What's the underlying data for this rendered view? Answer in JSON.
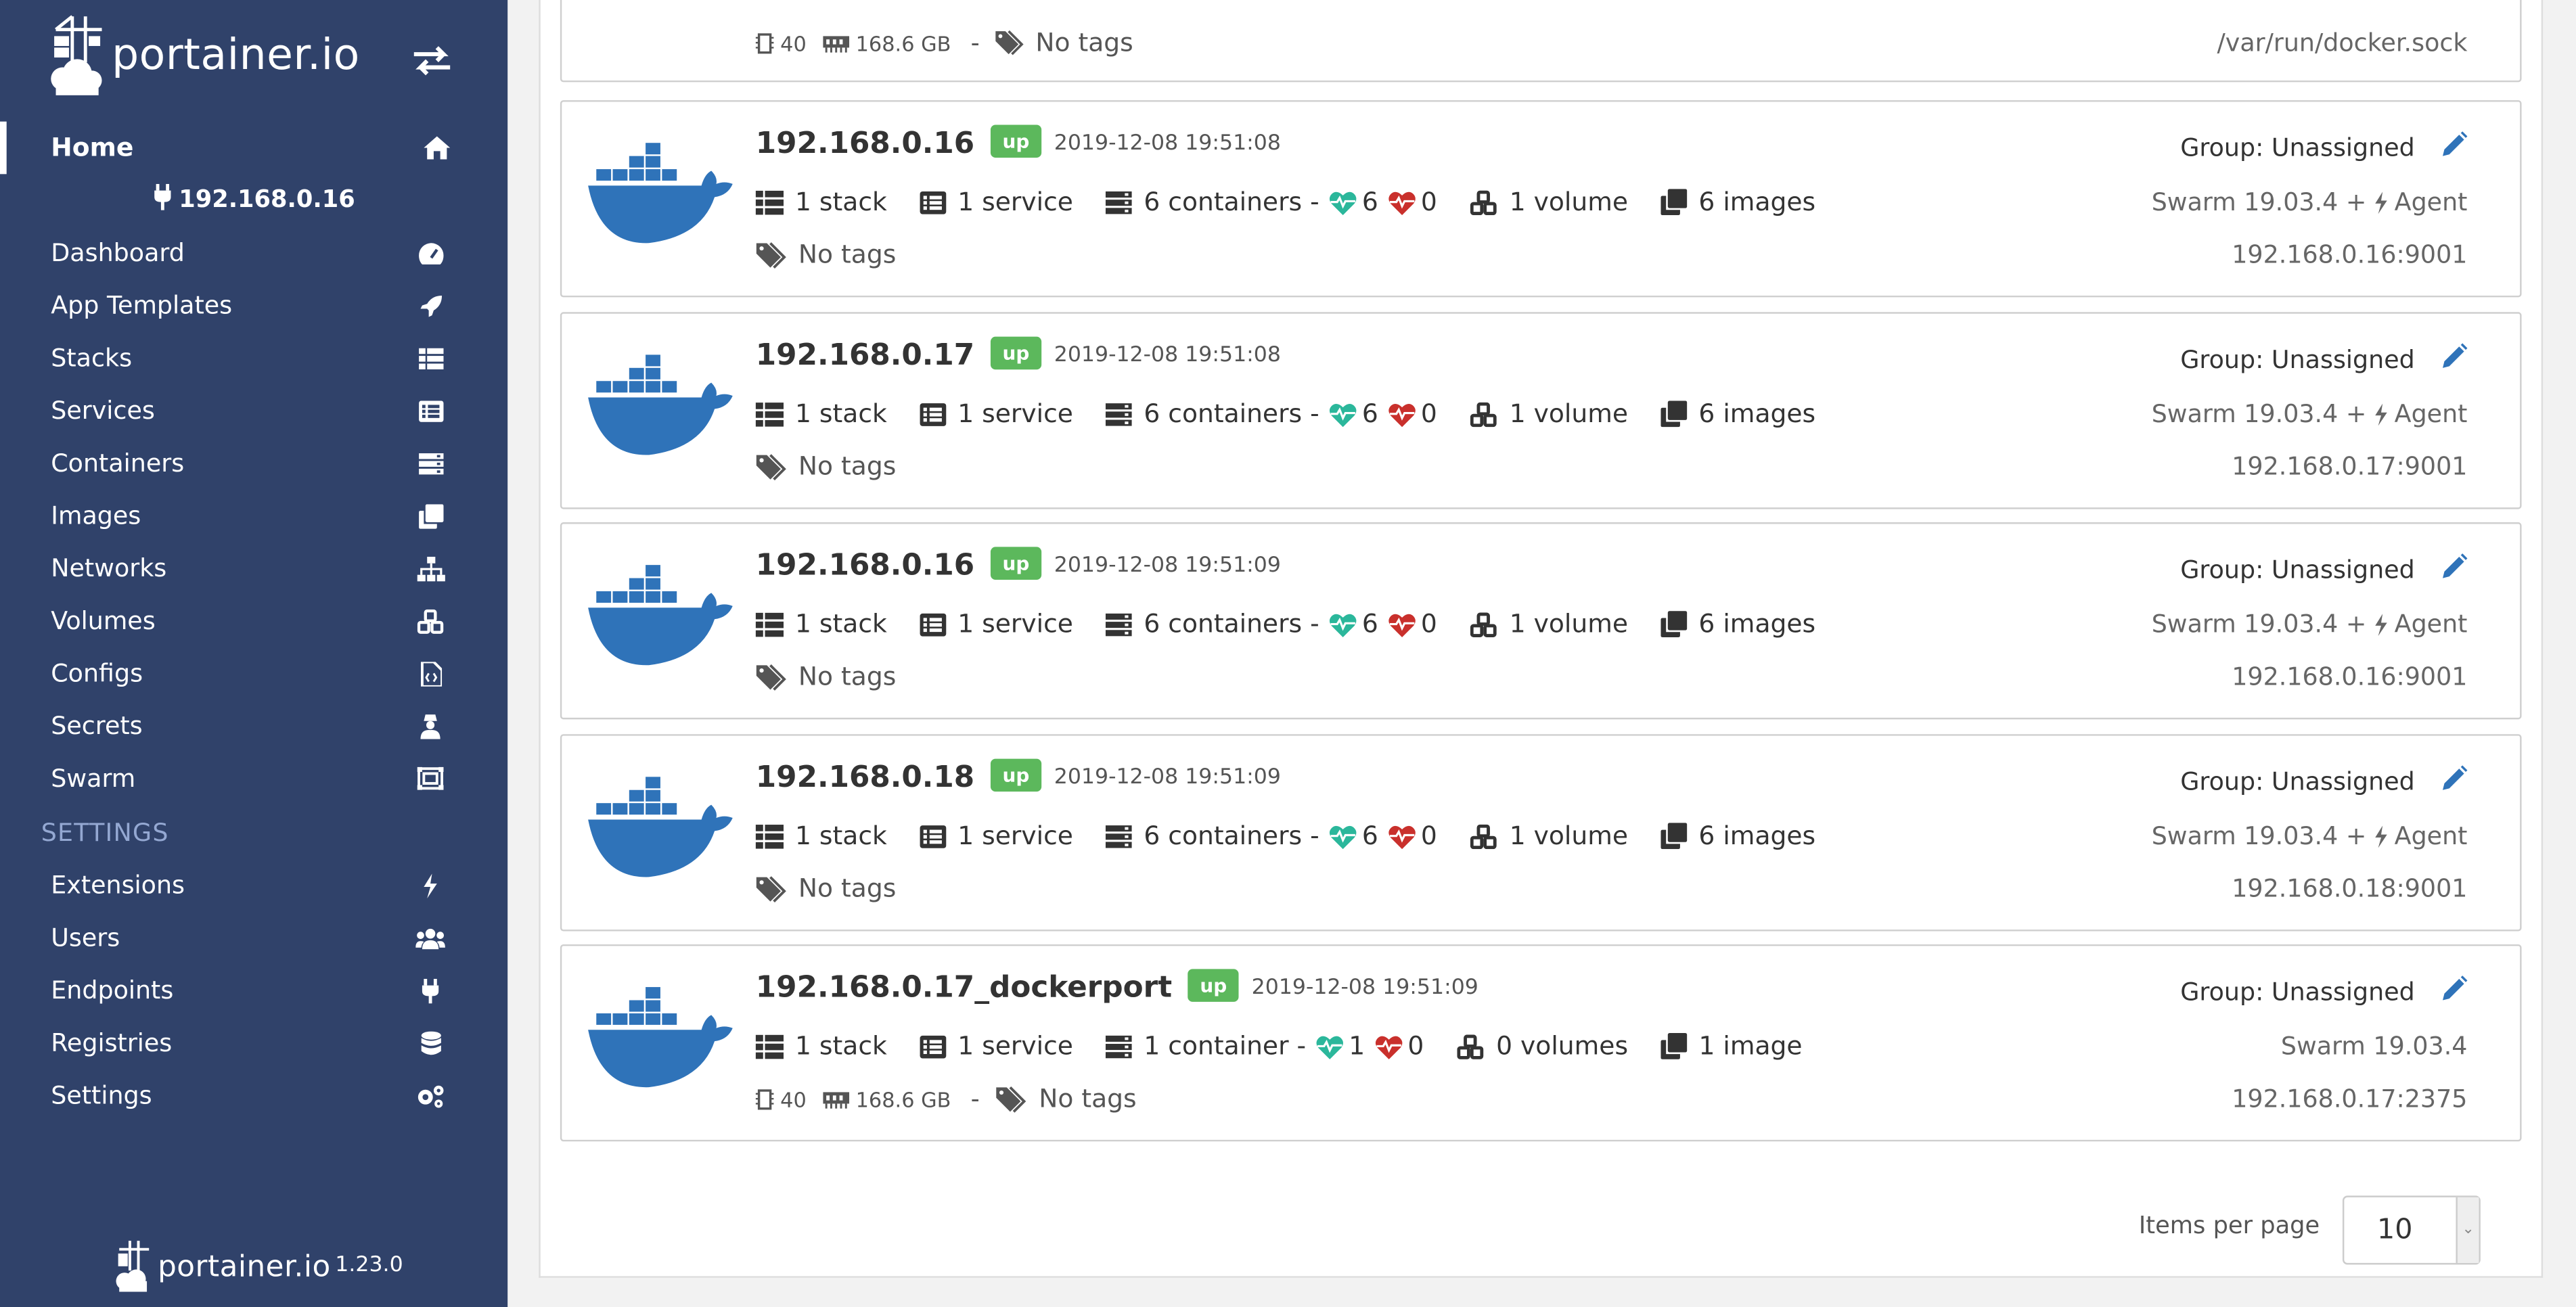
{
  "sidebar": {
    "brand": "portainer.io",
    "home": "Home",
    "endpoint": "192.168.0.16",
    "items": [
      {
        "label": "Dashboard",
        "icon": "tachometer-icon"
      },
      {
        "label": "App Templates",
        "icon": "rocket-icon"
      },
      {
        "label": "Stacks",
        "icon": "th-list-icon"
      },
      {
        "label": "Services",
        "icon": "list-alt-icon"
      },
      {
        "label": "Containers",
        "icon": "server-icon"
      },
      {
        "label": "Images",
        "icon": "clone-icon"
      },
      {
        "label": "Networks",
        "icon": "sitemap-icon"
      },
      {
        "label": "Volumes",
        "icon": "cubes-icon"
      },
      {
        "label": "Configs",
        "icon": "file-code-icon"
      },
      {
        "label": "Secrets",
        "icon": "user-secret-icon"
      },
      {
        "label": "Swarm",
        "icon": "object-group-icon"
      }
    ],
    "settings_header": "SETTINGS",
    "settings_items": [
      {
        "label": "Extensions",
        "icon": "bolt-icon"
      },
      {
        "label": "Users",
        "icon": "users-icon"
      },
      {
        "label": "Endpoints",
        "icon": "plug-icon"
      },
      {
        "label": "Registries",
        "icon": "database-icon"
      },
      {
        "label": "Settings",
        "icon": "cogs-icon"
      }
    ],
    "footer_brand": "portainer.io",
    "version": "1.23.0"
  },
  "top_partial": {
    "cpu": "40",
    "memory": "168.6 GB",
    "dash": "-",
    "tags": "No tags",
    "url": "/var/run/docker.sock"
  },
  "endpoints": [
    {
      "name": "192.168.0.16",
      "status": "up",
      "date": "2019-12-08 19:51:08",
      "stacks": "1 stack",
      "services": "1 service",
      "containers": "6 containers -",
      "healthy": "6",
      "unhealthy": "0",
      "volumes": "1 volume",
      "images": "6 images",
      "tags": "No tags",
      "group": "Group: Unassigned",
      "swarm": "Swarm 19.03.4 +",
      "agent": "Agent",
      "url": "192.168.0.16:9001"
    },
    {
      "name": "192.168.0.17",
      "status": "up",
      "date": "2019-12-08 19:51:08",
      "stacks": "1 stack",
      "services": "1 service",
      "containers": "6 containers -",
      "healthy": "6",
      "unhealthy": "0",
      "volumes": "1 volume",
      "images": "6 images",
      "tags": "No tags",
      "group": "Group: Unassigned",
      "swarm": "Swarm 19.03.4 +",
      "agent": "Agent",
      "url": "192.168.0.17:9001"
    },
    {
      "name": "192.168.0.16",
      "status": "up",
      "date": "2019-12-08 19:51:09",
      "stacks": "1 stack",
      "services": "1 service",
      "containers": "6 containers -",
      "healthy": "6",
      "unhealthy": "0",
      "volumes": "1 volume",
      "images": "6 images",
      "tags": "No tags",
      "group": "Group: Unassigned",
      "swarm": "Swarm 19.03.4 +",
      "agent": "Agent",
      "url": "192.168.0.16:9001"
    },
    {
      "name": "192.168.0.18",
      "status": "up",
      "date": "2019-12-08 19:51:09",
      "stacks": "1 stack",
      "services": "1 service",
      "containers": "6 containers -",
      "healthy": "6",
      "unhealthy": "0",
      "volumes": "1 volume",
      "images": "6 images",
      "tags": "No tags",
      "group": "Group: Unassigned",
      "swarm": "Swarm 19.03.4 +",
      "agent": "Agent",
      "url": "192.168.0.18:9001"
    },
    {
      "name": "192.168.0.17_dockerport",
      "status": "up",
      "date": "2019-12-08 19:51:09",
      "stacks": "1 stack",
      "services": "1 service",
      "containers": "1 container -",
      "healthy": "1",
      "unhealthy": "0",
      "volumes": "0 volumes",
      "images": "1 image",
      "cpu": "40",
      "memory": "168.6 GB",
      "dash": "-",
      "tags": "No tags",
      "group": "Group: Unassigned",
      "swarm": "Swarm 19.03.4",
      "url": "192.168.0.17:2375"
    }
  ],
  "pagination": {
    "label": "Items per page",
    "value": "10"
  },
  "colors": {
    "sidebar": "#30426a",
    "docker_blue": "#2f73b9",
    "up_green": "#5cb85c",
    "heart_green": "#2bb79b",
    "heart_red": "#c9302c"
  }
}
